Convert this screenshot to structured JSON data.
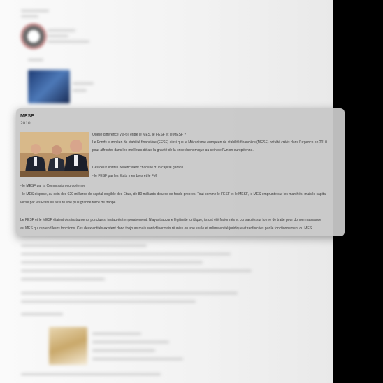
{
  "card": {
    "title": "MESF",
    "year": "2010",
    "paragraphs": [
      "Quelle différence y a-t-il entre le MES, le FESF et le MESF ?",
      "Le Fonds européen de stabilité financière (FESF) ainsi que le Mécanisme européen de stabilité financière (MESF) ont été créés dans l'urgence en 2010",
      "pour affronter dans les meilleurs délais la gravité de la crise économique au sein de l'Union européenne.",
      "Ces deux entités bénéficiaient chacune d'un capital garanti  :",
      "- le FESF par les Etats membres et le FMI",
      "- le MESF par la Commission européenne",
      "- le MES dispose, au sein des 620 milliards de capital exigible des Etats, de 80 milliards d'euros de fonds propres. Tout comme le FESF et le MESF, le MES emprunte sur les marchés, mais le capital",
      "versé par les Etats lui assure une plus grande force de frappe.",
      "Le FESF et le MESF étaient des instruments ponctuels, instaurés temporairement. N'ayant aucune légitimité juridique, ils ont été fusionnés et consacrés sur forme de traité pour donner naissance",
      "au MES qui reprend leurs fonctions. Ces deux entités existent donc toujours mais sont désormais réunies en une seule et même entité juridique et renforcées par le fonctionnement du MES."
    ]
  },
  "colors": {
    "card_bg": "#c8c8c8",
    "text": "#3a3a3a",
    "right_strip": "#000000"
  }
}
